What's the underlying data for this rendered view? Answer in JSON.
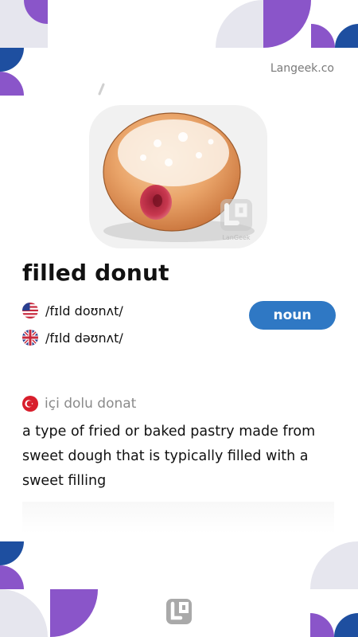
{
  "brand": {
    "name": "Langeek.co"
  },
  "word": {
    "headword": "filled donut"
  },
  "pronunciations": [
    {
      "accent": "US",
      "flag_icon": "us-flag-icon",
      "ipa": "/fɪld doʊnʌt/"
    },
    {
      "accent": "UK",
      "flag_icon": "uk-flag-icon",
      "ipa": "/fɪld dəʊnʌt/"
    }
  ],
  "part_of_speech": "noun",
  "translation": {
    "flag_icon": "turkey-flag-icon",
    "text": "içi dolu donat"
  },
  "definition": "a type of fried or baked pastry made from sweet dough that is typically filled with a sweet filling",
  "watermark": {
    "text": "LanGeek"
  },
  "colors": {
    "accent_blue": "#2f78c4",
    "purple": "#8a55c9",
    "navy": "#1e4fa0",
    "light_gray": "#e6e6ee"
  }
}
